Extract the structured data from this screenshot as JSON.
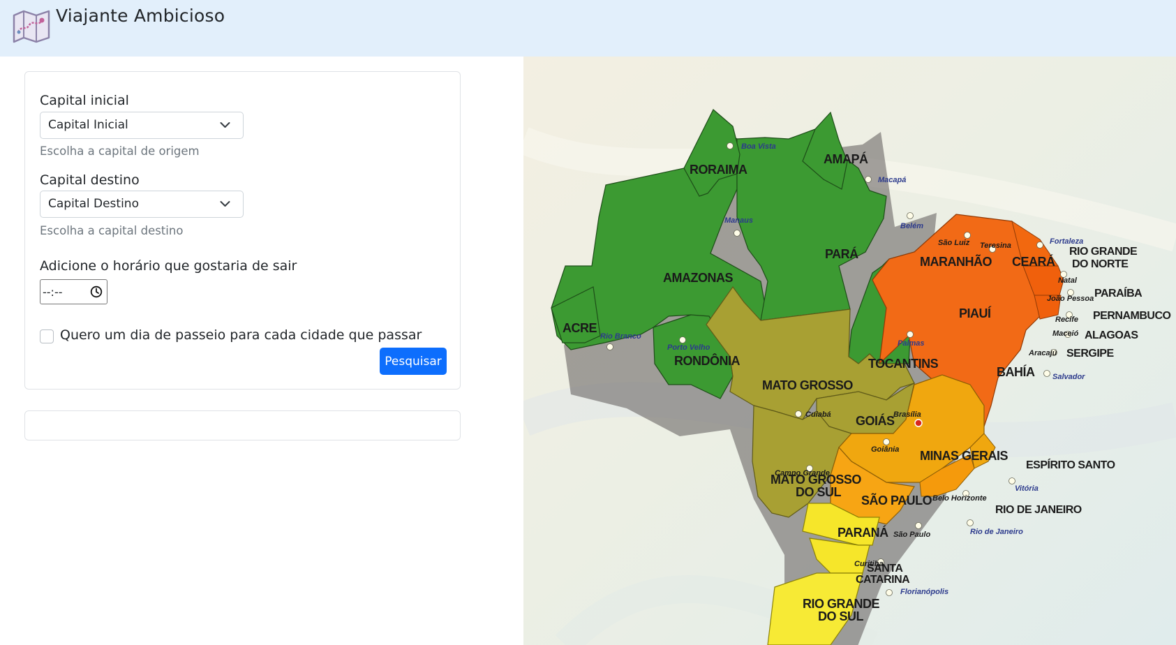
{
  "app": {
    "title": "Viajante Ambicioso"
  },
  "form": {
    "origin_label": "Capital inicial",
    "origin_value": "Capital Inicial",
    "origin_help": "Escolha a capital de origem",
    "destination_label": "Capital destino",
    "destination_value": "Capital Destino",
    "destination_help": "Escolha a capital destino",
    "time_label": "Adicione o horário que gostaria de sair",
    "time_value": "--:--",
    "checkbox_label": "Quero um dia de passeio para cada cidade que passar",
    "search_button": "Pesquisar"
  },
  "map": {
    "states": {
      "roraima": "RORAIMA",
      "amapa": "AMAPÁ",
      "amazonas": "AMAZONAS",
      "para": "PARÁ",
      "acre": "ACRE",
      "rondonia": "RONDÔNIA",
      "tocantins": "TOCANTINS",
      "maranhao": "MARANHÃO",
      "ceara": "CEARÁ",
      "rio_grande_do_norte_1": "RIO GRANDE",
      "rio_grande_do_norte_2": "DO NORTE",
      "paraiba": "PARAÍBA",
      "pernambuco": "PERNAMBUCO",
      "alagoas": "ALAGOAS",
      "sergipe": "SERGIPE",
      "piaui": "PIAUÍ",
      "bahia": "BAHÍA",
      "mato_grosso": "MATO GROSSO",
      "goias": "GOIÁS",
      "minas_gerais": "MINAS GERAIS",
      "espirito_santo": "ESPÍRITO SANTO",
      "mato_grosso_do_sul_1": "MATO GROSSO",
      "mato_grosso_do_sul_2": "DO SUL",
      "sao_paulo": "SÃO PAULO",
      "rio_de_janeiro": "RIO DE JANEIRO",
      "parana": "PARANÁ",
      "santa_catarina_1": "SANTA",
      "santa_catarina_2": "CATARINA",
      "rio_grande_do_sul_1": "RIO GRANDE",
      "rio_grande_do_sul_2": "DO SUL"
    },
    "capitals": {
      "boa_vista": "Boa Vista",
      "macapa": "Macapá",
      "manaus": "Manaus",
      "belem": "Belém",
      "sao_luiz": "São Luiz",
      "teresina": "Teresina",
      "fortaleza": "Fortaleza",
      "natal": "Natal",
      "joao_pessoa": "João Pessoa",
      "recife": "Recife",
      "maceio": "Maceió",
      "aracaju": "Aracajú",
      "salvador": "Salvador",
      "rio_branco": "Rio Branco",
      "porto_velho": "Porto Velho",
      "palmas": "Palmas",
      "cuiaba": "Cuiabá",
      "brasilia": "Brasília",
      "goiania": "Goiânia",
      "campo_grande": "Campo Grande",
      "belo_horizonte": "Belo Horizonte",
      "vitoria": "Vitória",
      "sao_paulo": "São Paulo",
      "rio_de_janeiro": "Rio de Janeiro",
      "curitiba": "Curitiba",
      "florianopolis": "Florianópolis"
    }
  }
}
